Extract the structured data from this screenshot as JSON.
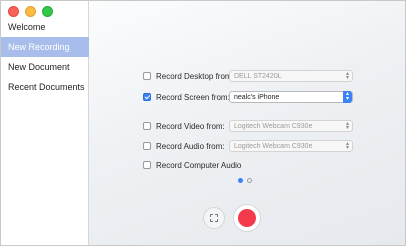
{
  "sidebar": {
    "items": [
      {
        "label": "Welcome"
      },
      {
        "label": "New Recording"
      },
      {
        "label": "New Document"
      },
      {
        "label": "Recent Documents"
      }
    ],
    "active_index": 1
  },
  "options": {
    "record_desktop": {
      "label": "Record Desktop from:",
      "checked": false,
      "value": "DELL ST2420L"
    },
    "record_screen": {
      "label": "Record Screen from:",
      "checked": true,
      "value": "nealc's iPhone"
    },
    "record_video": {
      "label": "Record Video from:",
      "checked": false,
      "value": "Logitech Webcam C930e"
    },
    "record_audio": {
      "label": "Record Audio from:",
      "checked": false,
      "value": "Logitech Webcam C930e"
    },
    "record_computer_audio": {
      "label": "Record Computer Audio",
      "checked": false
    }
  },
  "pager": {
    "current": 1,
    "total": 2
  },
  "colors": {
    "accent": "#3b82f6",
    "sidebar_active": "#a8bdeb",
    "record": "#f23a4b"
  },
  "icons": {
    "select_region": "dashed-square-icon",
    "record": "record-dot-icon",
    "dropdown": "chevron-updown-icon"
  }
}
